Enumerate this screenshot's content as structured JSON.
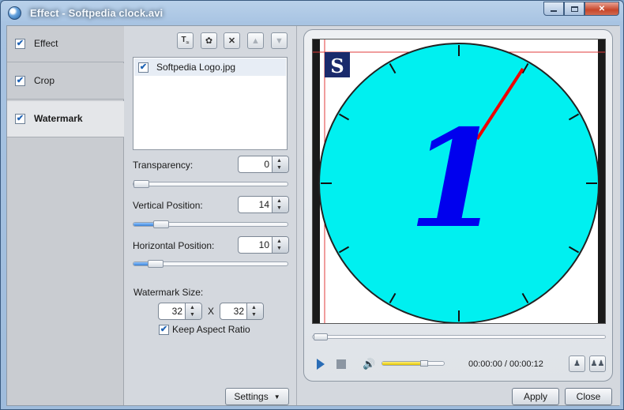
{
  "window": {
    "title": "Effect - Softpedia clock.avi",
    "minimize_icon": "minimize-icon",
    "maximize_icon": "maximize-icon",
    "close_glyph": "✕"
  },
  "categories": [
    {
      "label": "Effect",
      "checked": true,
      "selected": false
    },
    {
      "label": "Crop",
      "checked": true,
      "selected": false
    },
    {
      "label": "Watermark",
      "checked": true,
      "selected": true
    }
  ],
  "toolbar": {
    "icons": [
      "add-text-watermark-icon",
      "add-image-watermark-icon",
      "delete-icon",
      "move-up-icon",
      "move-down-icon"
    ]
  },
  "watermark_list": [
    {
      "label": "Softpedia Logo.jpg",
      "checked": true
    }
  ],
  "transparency": {
    "label": "Transparency:",
    "value": "0",
    "slider_fraction": 0.0
  },
  "vertical_position": {
    "label": "Vertical Position:",
    "value": "14",
    "slider_fraction": 0.14
  },
  "horizontal_position": {
    "label": "Horizontal Position:",
    "value": "10",
    "slider_fraction": 0.1
  },
  "watermark_size": {
    "label": "Watermark Size:",
    "width": "32",
    "separator": "X",
    "height": "32",
    "keep_aspect_label": "Keep Aspect Ratio",
    "keep_aspect_checked": true
  },
  "settings_button": {
    "label": "Settings",
    "icon": "dropdown-arrow-icon"
  },
  "player": {
    "time": "00:00:00 / 00:00:12",
    "volume_fraction": 0.69,
    "seek_fraction": 0.0,
    "logo_letter": "S",
    "clock_digit": "1",
    "colors": {
      "dial": "#00f0f0",
      "digit": "#0000ee",
      "hand": "#ee0000",
      "logo_bg": "#1a2a6c"
    }
  },
  "buttons": {
    "apply": "Apply",
    "close": "Close"
  }
}
